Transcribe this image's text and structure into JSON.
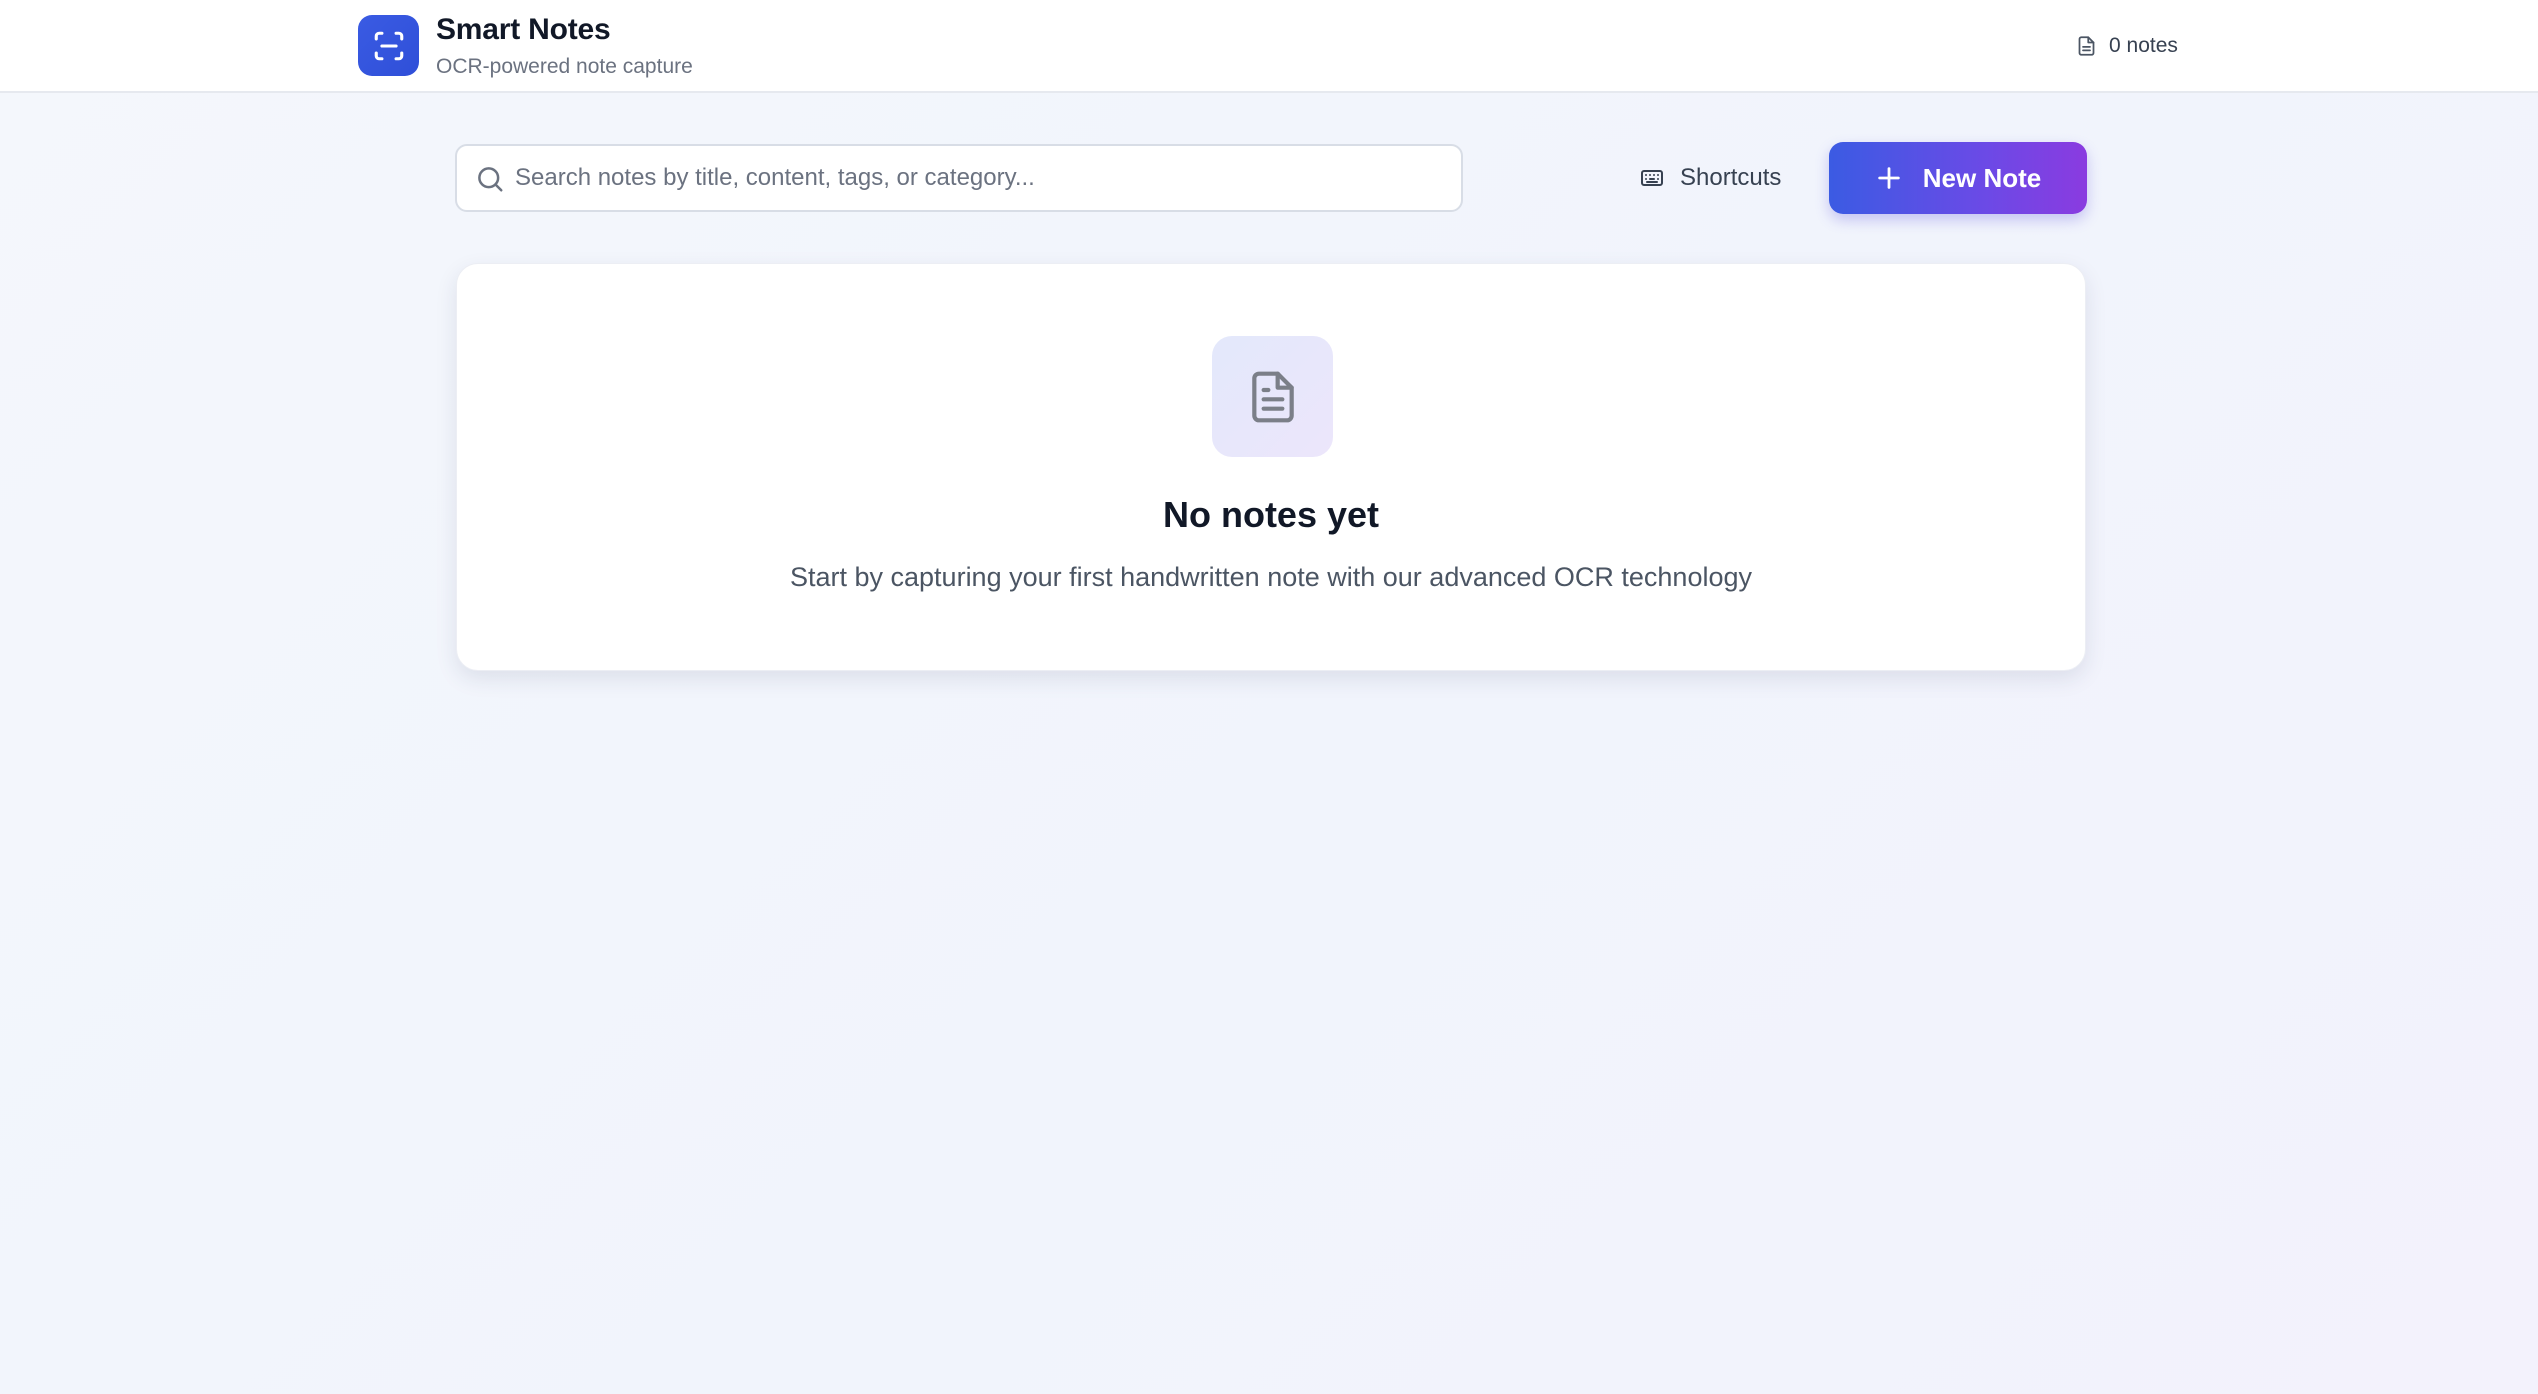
{
  "header": {
    "app_title": "Smart Notes",
    "app_subtitle": "OCR-powered note capture",
    "logo_icon": "scan-icon",
    "notes_count_label": "0 notes",
    "notes_count_icon": "file-icon"
  },
  "toolbar": {
    "search_placeholder": "Search notes by title, content, tags, or category...",
    "search_value": "",
    "search_icon": "search-icon",
    "shortcuts_label": "Shortcuts",
    "shortcuts_icon": "keyboard-icon",
    "new_note_label": "New Note",
    "new_note_icon": "plus-icon"
  },
  "empty_state": {
    "icon": "file-text-icon",
    "title": "No notes yet",
    "description": "Start by capturing your first handwritten note with our advanced OCR technology"
  },
  "colors": {
    "accent": "#3a5be3",
    "accent_gradient_end": "#8a3be0",
    "background": "#f3f6fc"
  }
}
